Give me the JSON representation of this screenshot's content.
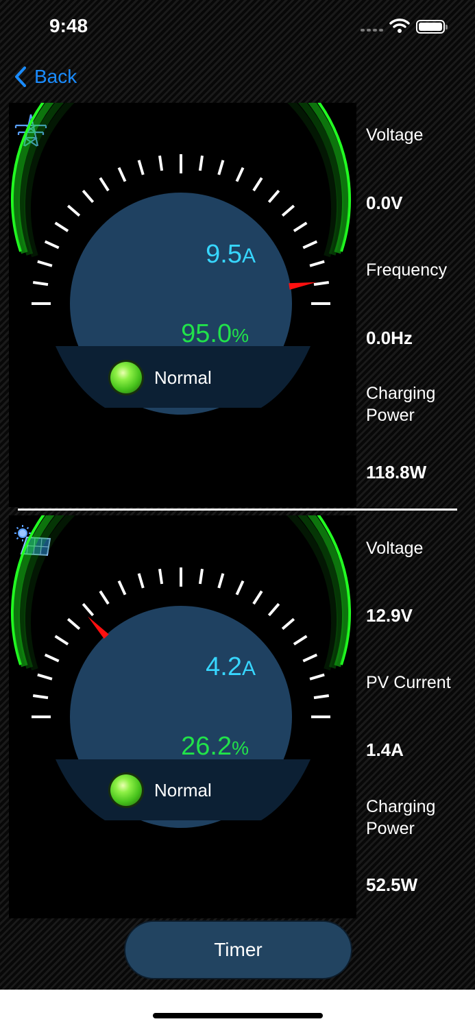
{
  "status_bar": {
    "time": "9:48"
  },
  "nav": {
    "back_label": "Back"
  },
  "grid_panel": {
    "icon": "power-tower-icon",
    "gauge": {
      "current": "9.5",
      "current_unit": "A",
      "percent": "95.0",
      "percent_unit": "%",
      "needle_fraction": 0.95,
      "status": "Normal"
    },
    "readings": [
      {
        "label": "Voltage",
        "value": "0.0V"
      },
      {
        "label": "Frequency",
        "value": "0.0Hz"
      },
      {
        "label": "Charging Power",
        "value": "118.8W"
      }
    ]
  },
  "pv_panel": {
    "icon": "solar-panel-icon",
    "gauge": {
      "current": "4.2",
      "current_unit": "A",
      "percent": "26.2",
      "percent_unit": "%",
      "needle_fraction": 0.262,
      "status": "Normal"
    },
    "readings": [
      {
        "label": "Voltage",
        "value": "12.9V"
      },
      {
        "label": "PV Current",
        "value": "1.4A"
      },
      {
        "label": "Charging Power",
        "value": "52.5W"
      }
    ]
  },
  "timer_label": "Timer",
  "colors": {
    "accent_blue": "#1a8cff",
    "gauge_green": "#21e24a",
    "current_cyan": "#37d6ff",
    "needle_red": "#ff1010",
    "dial_fill": "#1f4161"
  }
}
